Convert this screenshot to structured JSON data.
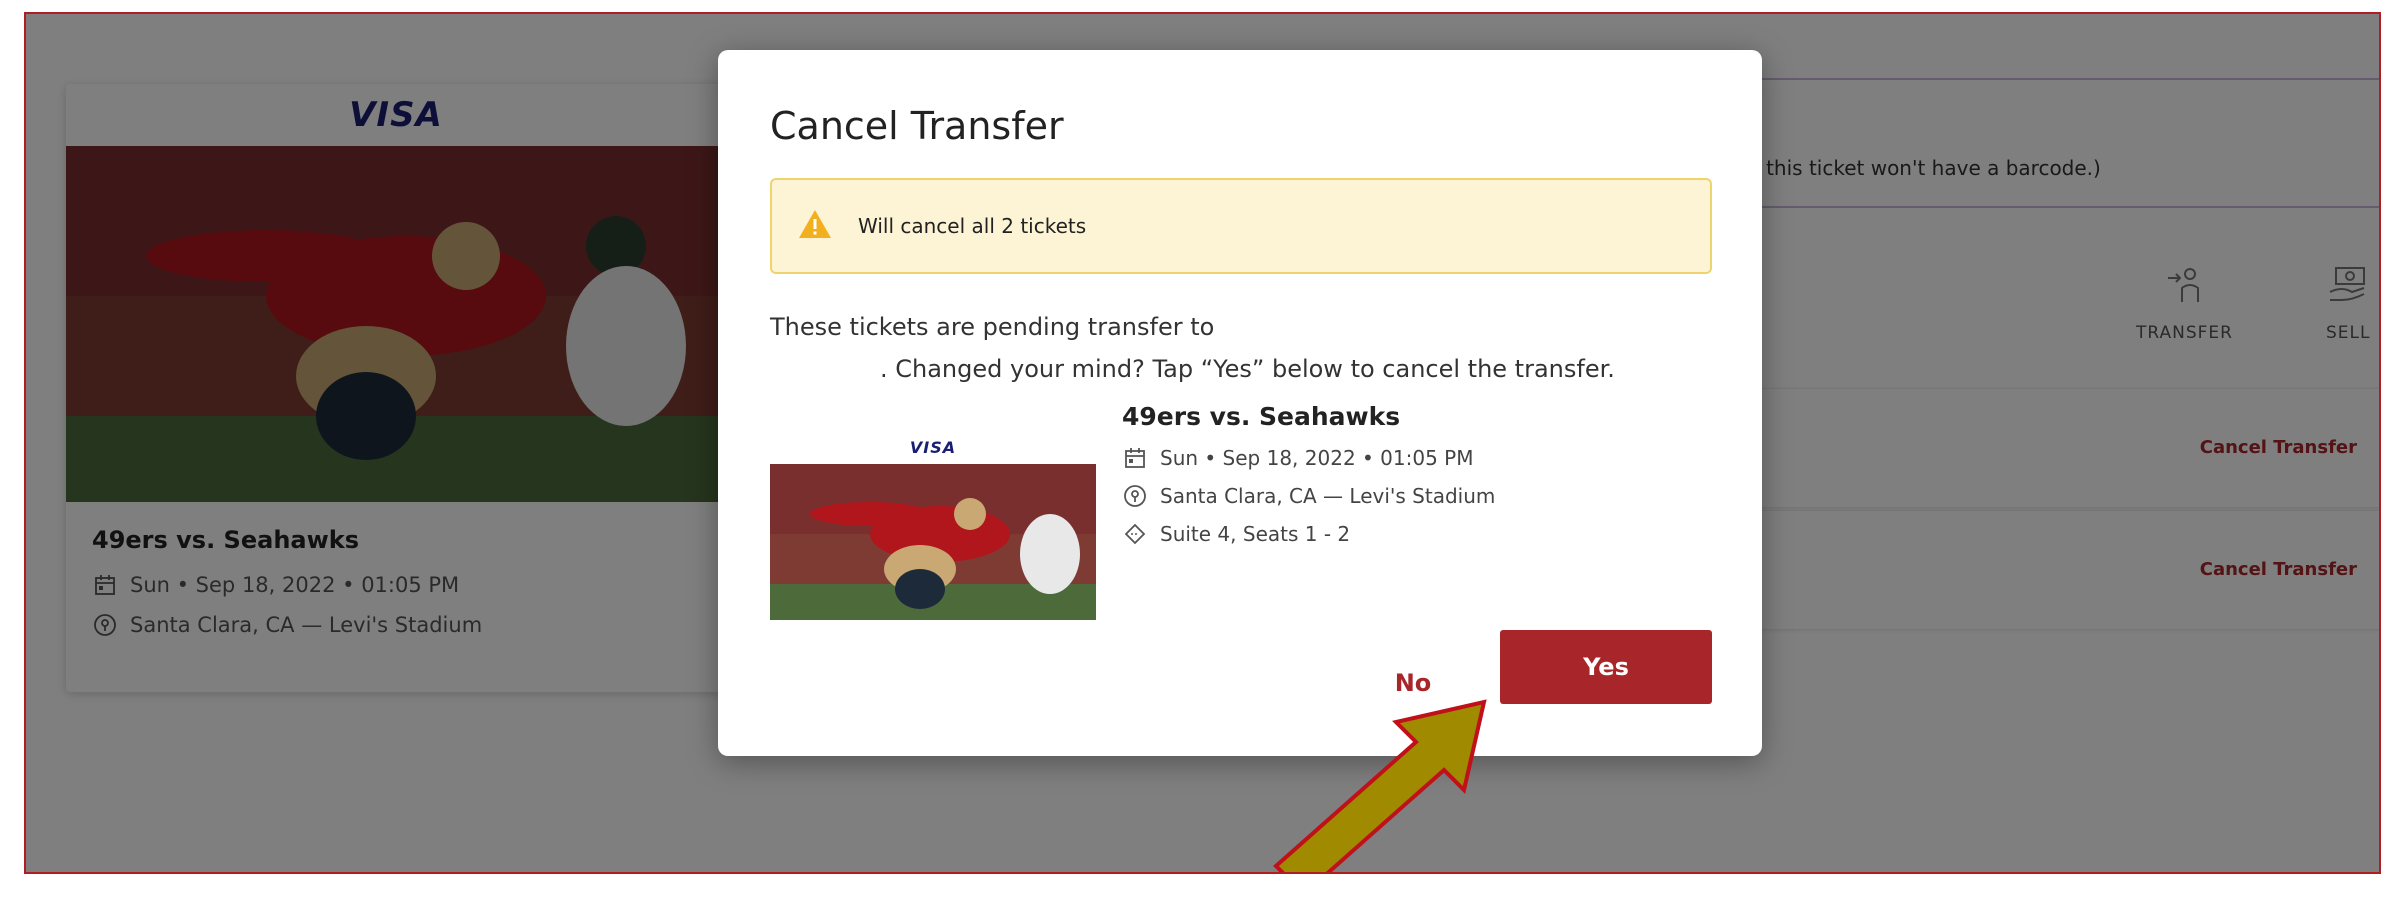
{
  "background": {
    "card": {
      "sponsor": "VISA",
      "title": "49ers vs. Seahawks",
      "date": "Sun • Sep 18, 2022 • 01:05 PM",
      "location": "Santa Clara, CA — Levi's Stadium"
    },
    "banner_text": "up, this ticket won't have a barcode.)",
    "actions": {
      "transfer": "TRANSFER",
      "sell": "SELL"
    },
    "rows": [
      {
        "link": "Cancel Transfer"
      },
      {
        "link": "Cancel Transfer"
      }
    ]
  },
  "modal": {
    "title": "Cancel Transfer",
    "warning": "Will cancel all 2 tickets",
    "message_line1": "These tickets are pending transfer to",
    "message_line2": ". Changed your mind? Tap “Yes” below to cancel the transfer.",
    "event": {
      "sponsor": "VISA",
      "title": "49ers vs. Seahawks",
      "date": "Sun • Sep 18, 2022 • 01:05 PM",
      "location": "Santa Clara, CA — Levi's Stadium",
      "seats": "Suite 4, Seats 1 - 2"
    },
    "no_label": "No",
    "yes_label": "Yes"
  },
  "colors": {
    "accent": "#a8262a",
    "warning_bg": "#fdf4d6",
    "warning_border": "#efd36c",
    "annotation_arrow": "#a08a00"
  },
  "icons": [
    "calendar-icon",
    "location-pin-icon",
    "ticket-icon",
    "warning-icon",
    "transfer-icon",
    "sell-icon"
  ]
}
